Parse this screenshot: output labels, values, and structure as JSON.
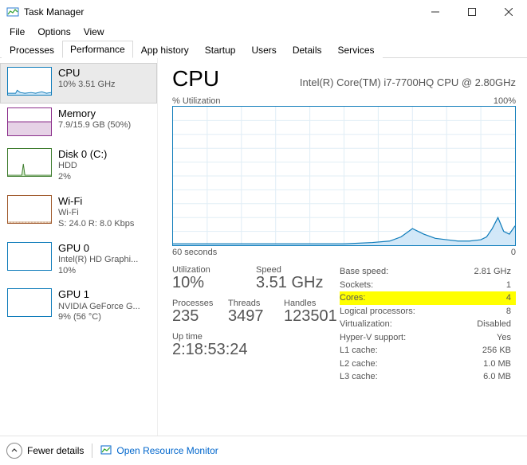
{
  "window": {
    "title": "Task Manager"
  },
  "menu": {
    "file": "File",
    "options": "Options",
    "view": "View"
  },
  "tabs": {
    "processes": "Processes",
    "performance": "Performance",
    "app_history": "App history",
    "startup": "Startup",
    "users": "Users",
    "details": "Details",
    "services": "Services"
  },
  "sidebar": [
    {
      "title": "CPU",
      "sub1": "10% 3.51 GHz",
      "sub2": "",
      "color": "#117dbb"
    },
    {
      "title": "Memory",
      "sub1": "7.9/15.9 GB (50%)",
      "sub2": "",
      "color": "#8b2e8b"
    },
    {
      "title": "Disk 0 (C:)",
      "sub1": "HDD",
      "sub2": "2%",
      "color": "#3f7d2f"
    },
    {
      "title": "Wi-Fi",
      "sub1": "Wi-Fi",
      "sub2": "S: 24.0 R: 8.0 Kbps",
      "color": "#a05a2c"
    },
    {
      "title": "GPU 0",
      "sub1": "Intel(R) HD Graphi...",
      "sub2": "10%",
      "color": "#117dbb"
    },
    {
      "title": "GPU 1",
      "sub1": "NVIDIA GeForce G...",
      "sub2": "9%  (56 °C)",
      "color": "#117dbb"
    }
  ],
  "main": {
    "title": "CPU",
    "model": "Intel(R) Core(TM) i7-7700HQ CPU @ 2.80GHz",
    "y_axis_label": "% Utilization",
    "y_axis_max": "100%",
    "x_axis_left": "60 seconds",
    "x_axis_right": "0",
    "stats_left": {
      "utilization_label": "Utilization",
      "utilization_value": "10%",
      "speed_label": "Speed",
      "speed_value": "3.51 GHz",
      "processes_label": "Processes",
      "processes_value": "235",
      "threads_label": "Threads",
      "threads_value": "3497",
      "handles_label": "Handles",
      "handles_value": "123501",
      "uptime_label": "Up time",
      "uptime_value": "2:18:53:24"
    },
    "stats_right": {
      "base_speed_k": "Base speed:",
      "base_speed_v": "2.81 GHz",
      "sockets_k": "Sockets:",
      "sockets_v": "1",
      "cores_k": "Cores:",
      "cores_v": "4",
      "logical_k": "Logical processors:",
      "logical_v": "8",
      "virt_k": "Virtualization:",
      "virt_v": "Disabled",
      "hyperv_k": "Hyper-V support:",
      "hyperv_v": "Yes",
      "l1_k": "L1 cache:",
      "l1_v": "256 KB",
      "l2_k": "L2 cache:",
      "l2_v": "1.0 MB",
      "l3_k": "L3 cache:",
      "l3_v": "6.0 MB"
    }
  },
  "footer": {
    "fewer_details": "Fewer details",
    "resource_monitor": "Open Resource Monitor"
  },
  "chart_data": {
    "type": "line",
    "title": "CPU % Utilization",
    "xlabel": "seconds ago",
    "ylabel": "% Utilization",
    "x_range": [
      60,
      0
    ],
    "ylim": [
      0,
      100
    ],
    "x": [
      60,
      55,
      50,
      45,
      40,
      35,
      30,
      25,
      22,
      20,
      18,
      16,
      14,
      12,
      10,
      8,
      6,
      5,
      4,
      3,
      2,
      1,
      0
    ],
    "values": [
      1,
      1,
      1,
      1,
      1,
      1,
      1,
      2,
      3,
      6,
      12,
      8,
      5,
      4,
      3,
      3,
      4,
      6,
      12,
      20,
      10,
      8,
      14
    ]
  }
}
